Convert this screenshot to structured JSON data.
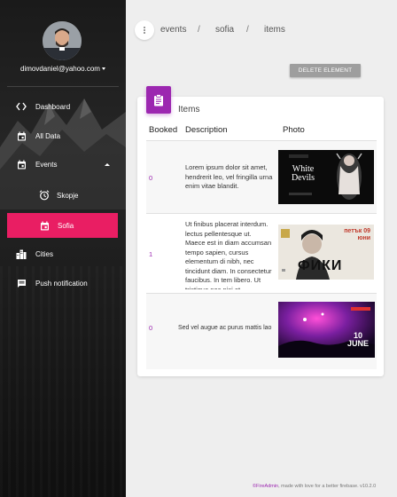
{
  "sidebar": {
    "user_email": "dimovdaniel@yahoo.com",
    "items": [
      {
        "label": "Dashboard",
        "icon": "code-icon"
      },
      {
        "label": "All Data",
        "icon": "calendar-icon"
      },
      {
        "label": "Events",
        "icon": "calendar-icon"
      },
      {
        "label": "Skopje",
        "icon": "alarm-icon"
      },
      {
        "label": "Sofia",
        "icon": "calendar-icon"
      },
      {
        "label": "Cities",
        "icon": "city-icon"
      },
      {
        "label": "Push notification",
        "icon": "chat-icon"
      }
    ]
  },
  "header": {
    "breadcrumb": [
      "events",
      "sofia",
      "items"
    ],
    "separator": "/"
  },
  "toolbar": {
    "delete_label": "DELETE ELEMENT"
  },
  "card": {
    "title": "Items",
    "columns": [
      "Booked",
      "Description",
      "Photo"
    ],
    "rows": [
      {
        "booked": "0",
        "description": "Lorem ipsum dolor sit amet, hendrerit leo, vel fringilla urna enim vitae blandit.",
        "photo_text": "White Devils"
      },
      {
        "booked": "1",
        "description": "Ut finibus placerat interdum. lectus pellentesque ut. Maece est in diam accumsan tempo sapien, cursus elementum di nibh, nec tincidunt diam. In consectetur faucibus. In tem libero. Ut tristique nec nisi et",
        "photo_text": "ФИКИ",
        "photo_badge": "петък 09 юни"
      },
      {
        "booked": "0",
        "description": "Sed vel augue ac purus mattis lao",
        "photo_text": "10 JUNE"
      }
    ]
  },
  "footer": {
    "brand": "©FireAdmin",
    "text": ", made with love for a better firebase.",
    "version": " v10.2.0"
  },
  "colors": {
    "accent": "#e91e63",
    "primary": "#9c27b0"
  }
}
